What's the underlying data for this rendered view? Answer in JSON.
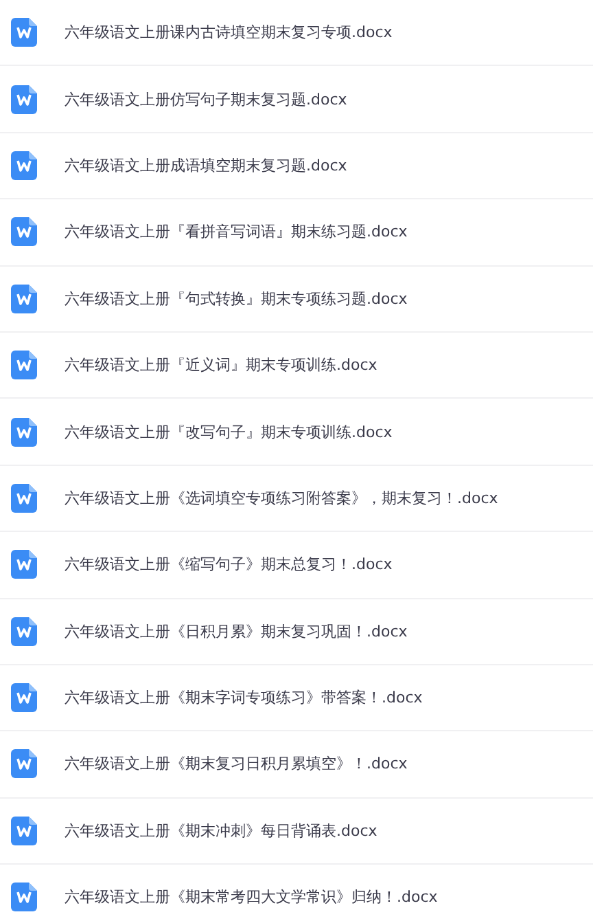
{
  "files": [
    {
      "name": "六年级语文上册课内古诗填空期末复习专项.docx"
    },
    {
      "name": "六年级语文上册仿写句子期末复习题.docx"
    },
    {
      "name": "六年级语文上册成语填空期末复习题.docx"
    },
    {
      "name": "六年级语文上册『看拼音写词语』期末练习题.docx"
    },
    {
      "name": "六年级语文上册『句式转换』期末专项练习题.docx"
    },
    {
      "name": "六年级语文上册『近义词』期末专项训练.docx"
    },
    {
      "name": "六年级语文上册『改写句子』期末专项训练.docx"
    },
    {
      "name": "六年级语文上册《选词填空专项练习附答案》，期末复习！.docx"
    },
    {
      "name": "六年级语文上册《缩写句子》期末总复习！.docx"
    },
    {
      "name": "六年级语文上册《日积月累》期末复习巩固！.docx"
    },
    {
      "name": "六年级语文上册《期末字词专项练习》带答案！.docx"
    },
    {
      "name": "六年级语文上册《期末复习日积月累填空》！.docx"
    },
    {
      "name": "六年级语文上册《期末冲刺》每日背诵表.docx"
    },
    {
      "name": "六年级语文上册《期末常考四大文学常识》归纳！.docx"
    }
  ]
}
